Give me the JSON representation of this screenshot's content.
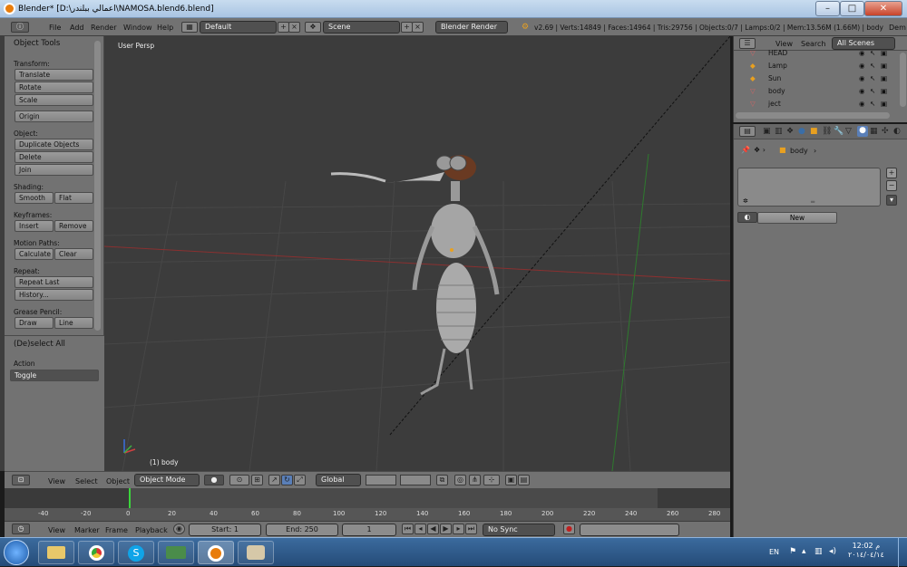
{
  "window": {
    "title": "Blender* [D:\\اعمالي ببلندر\\NAMOSA.blend6.blend]",
    "min": "–",
    "max": "□",
    "close": "✕"
  },
  "infobar": {
    "menus": [
      "File",
      "Add",
      "Render",
      "Window",
      "Help"
    ],
    "layout": "Default",
    "scene": "Scene",
    "engine": "Blender Render",
    "stats": "v2.69 | Verts:14849 | Faces:14964 | Tris:29756 | Objects:0/7 | Lamps:0/2 | Mem:13.56M (1.66M) | body",
    "extra": "Dem"
  },
  "toolshelf": {
    "title": "Object Tools",
    "transform_label": "Transform:",
    "translate": "Translate",
    "rotate": "Rotate",
    "scale": "Scale",
    "origin": "Origin",
    "object_label": "Object:",
    "duplicate": "Duplicate Objects",
    "delete": "Delete",
    "join": "Join",
    "shading_label": "Shading:",
    "smooth": "Smooth",
    "flat": "Flat",
    "keyframes_label": "Keyframes:",
    "insert": "Insert",
    "remove": "Remove",
    "motion_label": "Motion Paths:",
    "calculate": "Calculate",
    "clear": "Clear",
    "repeat_label": "Repeat:",
    "repeat_last": "Repeat Last",
    "history": "History...",
    "grease_label": "Grease Pencil:",
    "draw": "Draw",
    "line": "Line",
    "deselect_title": "(De)select All",
    "action_label": "Action",
    "action_value": "Toggle"
  },
  "viewport": {
    "label": "User Persp",
    "object": "(1) body"
  },
  "vpheader": {
    "view": "View",
    "select": "Select",
    "object": "Object",
    "mode": "Object Mode",
    "orientation": "Global"
  },
  "timeline": {
    "ticks": [
      "-40",
      "-20",
      "0",
      "20",
      "40",
      "60",
      "80",
      "100",
      "120",
      "140",
      "160",
      "180",
      "200",
      "220",
      "240",
      "260",
      "280"
    ],
    "view": "View",
    "marker": "Marker",
    "frame": "Frame",
    "playback": "Playback",
    "start": "Start: 1",
    "end": "End: 250",
    "current": "1",
    "sync": "No Sync"
  },
  "outliner": {
    "view": "View",
    "search": "Search",
    "scenes": "All Scenes",
    "items": [
      "HEAD",
      "Lamp",
      "Sun",
      "body",
      "ject"
    ]
  },
  "properties": {
    "breadcrumb": "body",
    "new_button": "New"
  },
  "taskbar": {
    "lang": "EN",
    "time": "12:02 م",
    "date": "٢٠١٤/٠٤/١٤"
  }
}
